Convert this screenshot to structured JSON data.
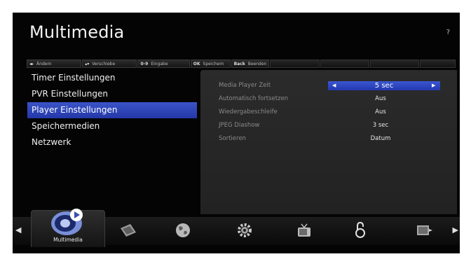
{
  "header": {
    "title": "Multimedia",
    "help": "?"
  },
  "hints": [
    {
      "key": "◂▸",
      "label": "Ändern"
    },
    {
      "key": "▴▾",
      "label": "Verschiebe"
    },
    {
      "key": "0-9",
      "label": "Eingabe"
    },
    {
      "key": "OK",
      "label": "Speichern"
    },
    {
      "key": "Back",
      "label": "Beenden"
    }
  ],
  "menu": {
    "items": [
      {
        "label": "Timer Einstellungen"
      },
      {
        "label": "PVR Einstellungen"
      },
      {
        "label": "Player Einstellungen",
        "selected": true
      },
      {
        "label": "Speichermedien"
      },
      {
        "label": "Netzwerk"
      }
    ]
  },
  "settings": {
    "rows": [
      {
        "label": "Media Player Zeit",
        "value": "5 sec",
        "selected": true
      },
      {
        "label": "Automatisch fortsetzen",
        "value": "Aus"
      },
      {
        "label": "Wiedergabeschleife",
        "value": "Aus"
      },
      {
        "label": "JPEG Diashow",
        "value": "3 sec"
      },
      {
        "label": "Sortieren",
        "value": "Datum"
      }
    ]
  },
  "bottom": {
    "selected_label": "Multimedia",
    "icons": [
      "multimedia-icon",
      "satellite-dish-icon",
      "globe-icon",
      "gear-icon",
      "tv-icon",
      "lock-icon",
      "folder-icon"
    ]
  },
  "colors": {
    "accent": "#2d44bd",
    "panel": "#262626",
    "background": "#040404"
  }
}
